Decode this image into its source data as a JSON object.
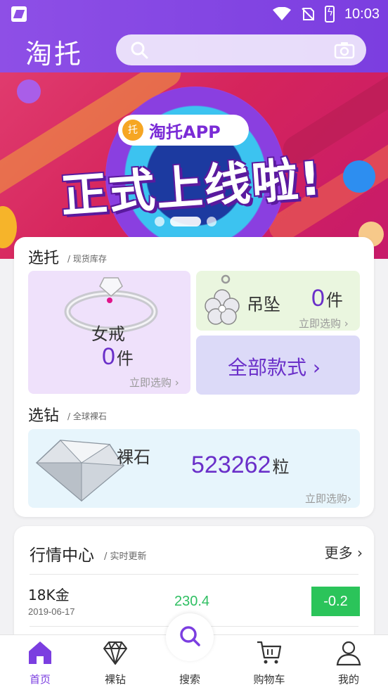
{
  "status_bar": {
    "time": "10:03"
  },
  "header": {
    "logo": "淘托",
    "search_placeholder": ""
  },
  "banner": {
    "badge": "托",
    "app_name": "淘托APP",
    "headline": "正式上线啦!"
  },
  "select_tuo": {
    "title": "选托",
    "subtitle": "/ 现货库存",
    "ring": {
      "label": "女戒",
      "count": "0",
      "unit": "件",
      "action": "立即选购 ›"
    },
    "pendant": {
      "label": "吊坠",
      "count": "0",
      "unit": "件",
      "action": "立即选购 ›"
    },
    "all_styles": "全部款式 ›"
  },
  "select_diamond": {
    "title": "选钻",
    "subtitle": "/ 全球裸石",
    "label": "裸石",
    "count": "523262",
    "unit": "粒",
    "action": "立即选购›"
  },
  "market": {
    "title": "行情中心",
    "subtitle": "/ 实时更新",
    "more": "更多 ›",
    "rows": [
      {
        "name": "18K金",
        "date": "2019-06-17",
        "price": "230.4",
        "change": "-0.2"
      }
    ]
  },
  "nav": {
    "items": [
      {
        "label": "首页",
        "icon": "home-icon"
      },
      {
        "label": "裸钻",
        "icon": "diamond-icon"
      },
      {
        "label": "搜索",
        "icon": "search-icon"
      },
      {
        "label": "购物车",
        "icon": "cart-icon"
      },
      {
        "label": "我的",
        "icon": "user-icon"
      }
    ]
  },
  "colors": {
    "brand": "#7b3ee0",
    "up_down_green": "#2bc45a"
  }
}
